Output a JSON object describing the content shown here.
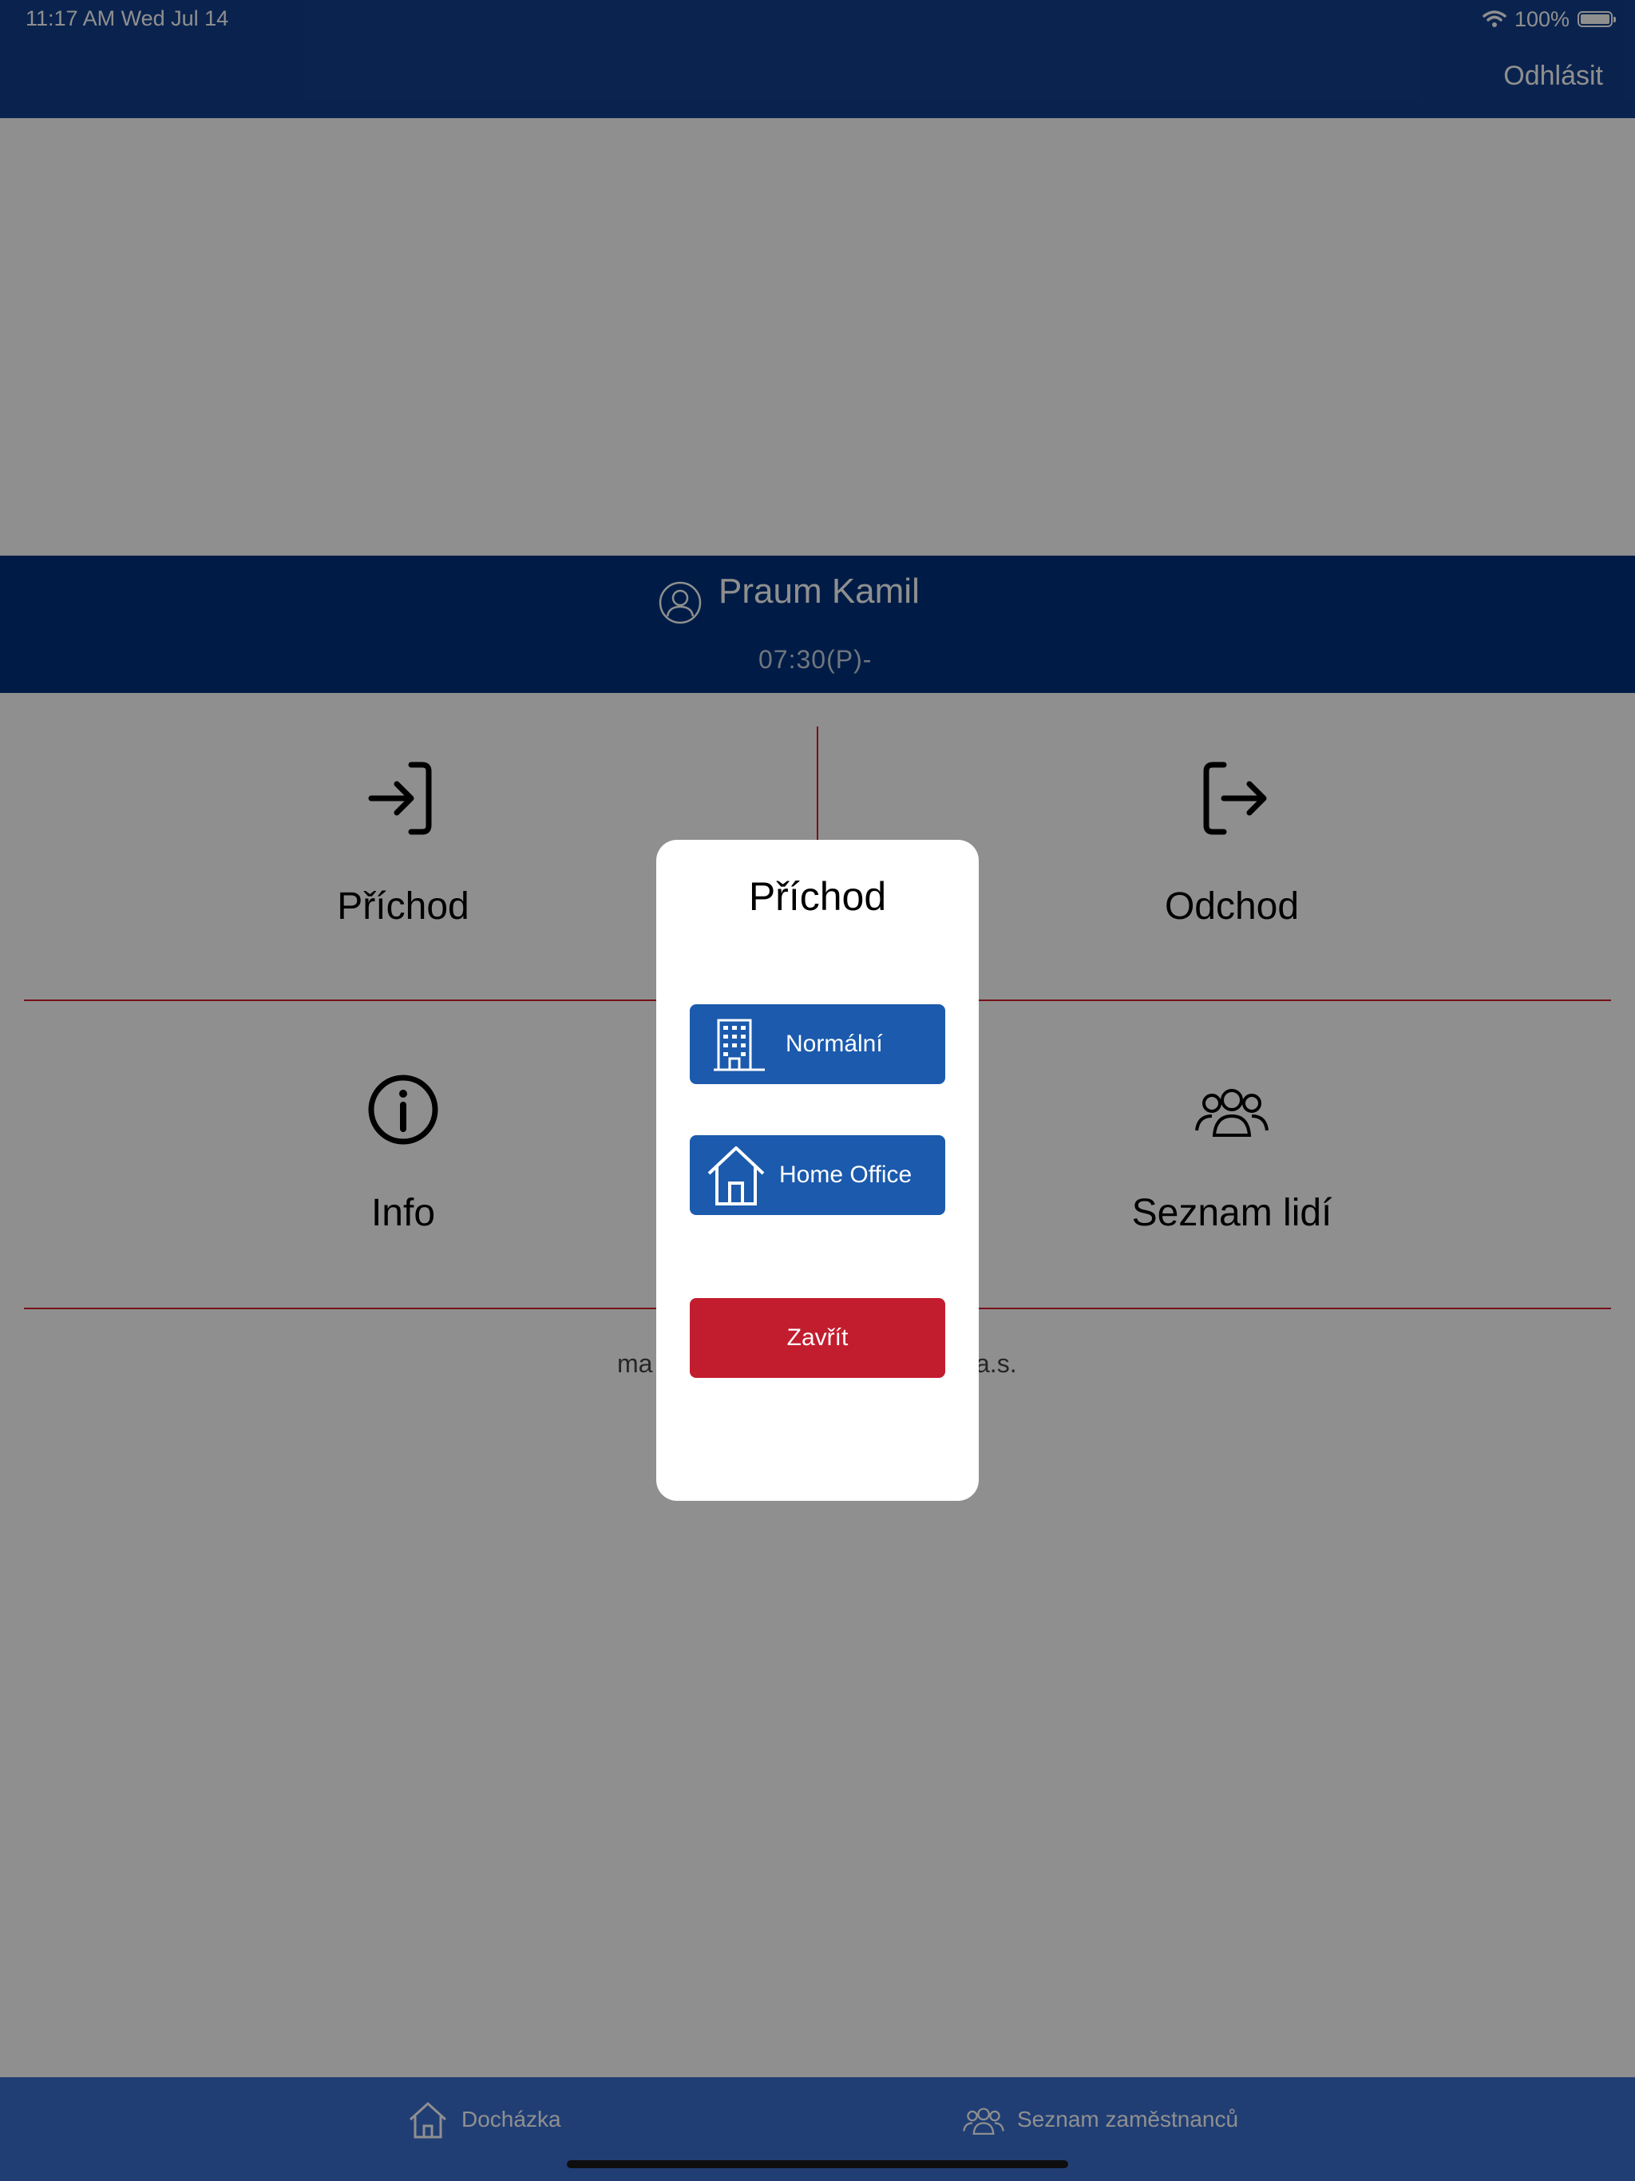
{
  "status_bar": {
    "time": "11:17 AM   Wed Jul 14",
    "battery": "100%"
  },
  "nav": {
    "logout_label": "Odhlásit"
  },
  "user": {
    "name": "Praum Kamil",
    "time": "07:30(P)-"
  },
  "tiles": [
    {
      "label": "Příchod",
      "icon": "login-icon"
    },
    {
      "label": "Odchod",
      "icon": "logout-icon"
    },
    {
      "label": "Info",
      "icon": "info-icon"
    },
    {
      "label": "Seznam lidí",
      "icon": "people-icon"
    }
  ],
  "company": {
    "text_left": "ma",
    "text_right": "a.s."
  },
  "modal": {
    "title": "Příchod",
    "normal_label": "Normální",
    "home_office_label": "Home Office",
    "close_label": "Zavřít"
  },
  "tabbar": {
    "tabs": [
      {
        "label": "Docházka",
        "icon": "home-icon"
      },
      {
        "label": "Seznam zaměstnanců",
        "icon": "people-icon"
      }
    ]
  },
  "colors": {
    "nav_blue": "#123f8c",
    "band_blue": "#01327d",
    "divider_red": "#d21f2e",
    "button_blue": "#1b5aad",
    "button_red": "#c21d2e"
  }
}
